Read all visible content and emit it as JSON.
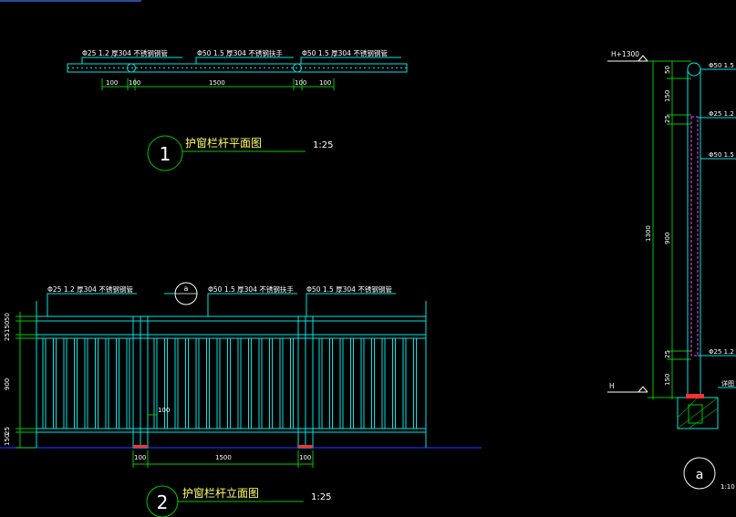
{
  "colors": {
    "background": "#000000",
    "rail": "#00e5e5",
    "dimension": "#00c800",
    "text": "#ffffff",
    "label": "#ffff66",
    "ground": "#1428c8",
    "post_base": "#ff3030",
    "hatch": "#ff40ff"
  },
  "plan_view": {
    "notes": [
      "Φ25  1.2  厚304  不锈钢钢管",
      "Φ50  1.5  厚304  不锈钢扶手",
      "Φ50  1.5  厚304  不锈钢钢管"
    ],
    "dims": [
      "100",
      "100",
      "1500",
      "100",
      "100"
    ],
    "number": "1",
    "title": "护窗栏杆平面图",
    "scale": "1:25"
  },
  "elevation_view": {
    "notes": [
      "Φ25  1.2  厚304  不锈钢钢管",
      "Φ50  1.5  厚304  不锈钢扶手",
      "Φ50  1.5  厚304  不锈钢钢管"
    ],
    "detail_mark": "a",
    "left_dims": [
      "50",
      "150",
      "25",
      "900",
      "25",
      "150"
    ],
    "post_dim": "100",
    "bottom_dims": [
      "100",
      "1500",
      "100"
    ],
    "number": "2",
    "title": "护窗栏杆立面图",
    "scale": "1:25"
  },
  "section_detail": {
    "top_level": "H+1300",
    "bottom_level": "H",
    "left_dims": [
      "50",
      "150",
      "25",
      "900",
      "25",
      "150"
    ],
    "total_dim": "1300",
    "notes": [
      "Φ50  1.5",
      "Φ25  1.2",
      "Φ50  1.5",
      "Φ25  1.2"
    ],
    "extra_note": "详图",
    "mark": "a",
    "scale": "1:10"
  }
}
